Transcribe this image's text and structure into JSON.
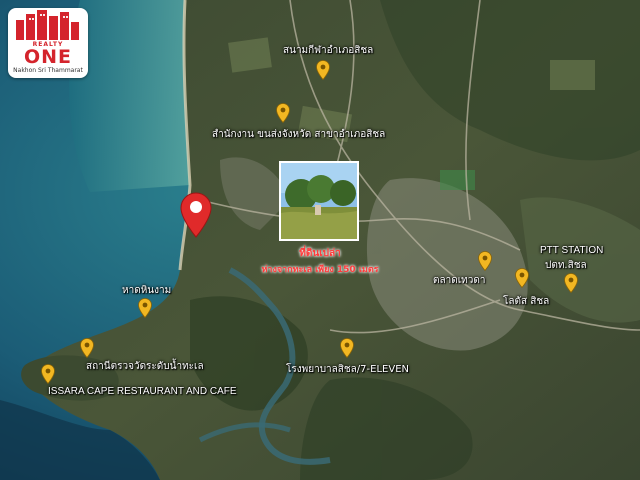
{
  "logo": {
    "brand_top": "REALTY",
    "brand_main": "ONE",
    "brand_city": "Nakhon Sri Thammarat",
    "color": "#d4242c"
  },
  "listing": {
    "title": "ที่ดินเปล่า",
    "subtitle": "ห่างจากทะเล เพียง 150 เมตร",
    "accent_color": "#ff3c3c",
    "pin_icon": "red-location-pin-icon"
  },
  "places": [
    {
      "id": "stadium",
      "label": "สนามกีฬาอำเภอสิชล",
      "icon": "yellow-pin-icon"
    },
    {
      "id": "transport",
      "label": "สำนักงาน ขนส่งจังหวัด สาขาอำเภอสิชล",
      "icon": "yellow-pin-icon"
    },
    {
      "id": "beach",
      "label": "หาดหินงาม",
      "icon": "yellow-pin-icon"
    },
    {
      "id": "viewpoint",
      "label": "สถานีตรวจวัดระดับน้ำทะเล",
      "icon": "yellow-pin-icon"
    },
    {
      "id": "restaurant",
      "label": "ISSARA CAPE RESTAURANT AND CAFE",
      "icon": "yellow-pin-icon"
    },
    {
      "id": "market",
      "label": "ตลาดเทวดา",
      "icon": "yellow-pin-icon"
    },
    {
      "id": "lotus",
      "label": "โลตัส สิชล",
      "icon": "yellow-pin-icon"
    },
    {
      "id": "ptt_en",
      "label": "PTT STATION",
      "icon": ""
    },
    {
      "id": "ptt_th",
      "label": "ปตท.สิชล",
      "icon": "yellow-pin-icon"
    },
    {
      "id": "hospital",
      "label": "โรงพยาบาลสิชล/7-ELEVEN",
      "icon": "yellow-pin-icon"
    }
  ]
}
